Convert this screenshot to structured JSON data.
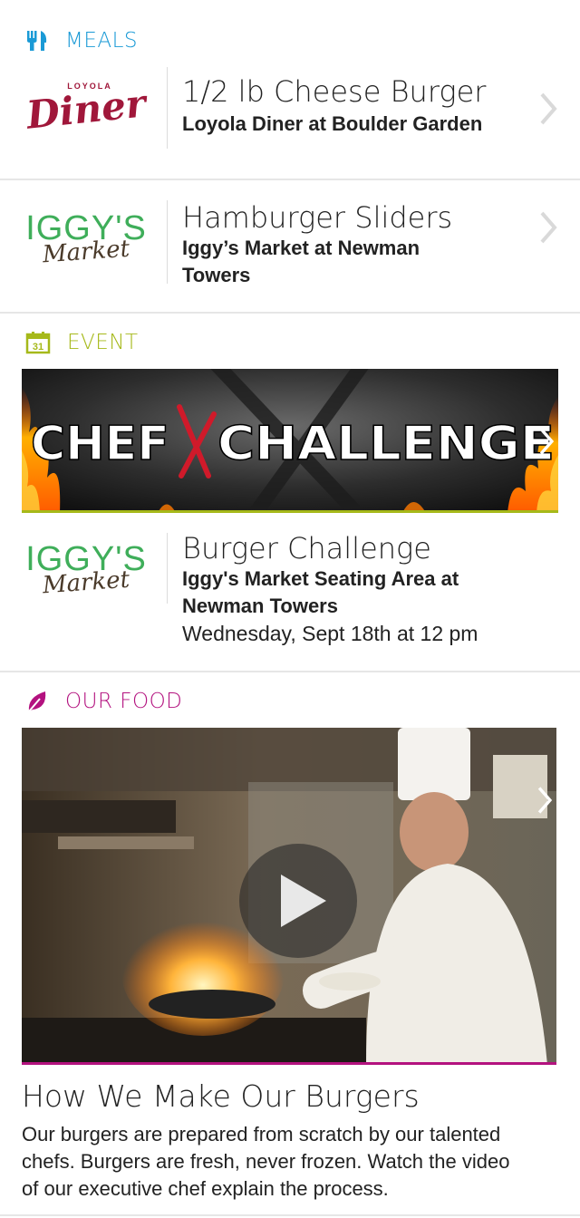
{
  "colors": {
    "meals": "#1a9ad6",
    "event": "#a6b91a",
    "food": "#b3127f",
    "diner_red": "#a0173a",
    "iggys_green": "#3fae5a",
    "iggys_brown": "#4a3a2a"
  },
  "meals": {
    "header_label": "MEALS",
    "header_icon": "fork-knife-icon",
    "items": [
      {
        "logo_top": "LOYOLA",
        "logo_main": "Diner",
        "title": "1/2 lb Cheese Burger",
        "subtitle": "Loyola Diner at Boulder Garden"
      },
      {
        "logo_top": "IGGY'S",
        "logo_main": "Market",
        "title": "Hamburger Sliders",
        "subtitle_line1": "Iggy’s Market at Newman",
        "subtitle_line2": "Towers"
      }
    ]
  },
  "event": {
    "header_label": "EVENT",
    "header_icon": "calendar-icon",
    "calendar_day": "31",
    "banner_left": "CHEF",
    "banner_right": "CHALLENGE",
    "logo_top": "IGGY'S",
    "logo_main": "Market",
    "title": "Burger Challenge",
    "subtitle_line1": "Iggy's Market Seating Area at",
    "subtitle_line2": "Newman Towers",
    "datetime": "Wednesday, Sept 18th at 12 pm"
  },
  "food": {
    "header_label": "OUR FOOD",
    "header_icon": "leaf-icon",
    "video_title": "How We Make Our Burgers",
    "body_line1": "Our burgers are prepared from scratch by our talented",
    "body_line2": "chefs. Burgers are fresh, never frozen. Watch the video",
    "body_line3": "of our executive chef explain the process."
  }
}
